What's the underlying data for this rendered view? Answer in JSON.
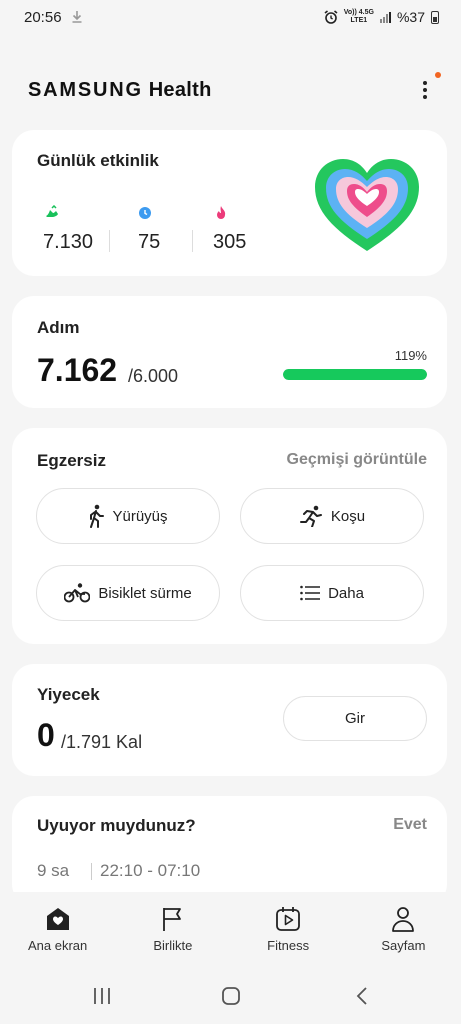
{
  "status": {
    "time": "20:56",
    "net_top": "Vo)) 4.5G",
    "net_bottom": "LTE1",
    "battery": "%37"
  },
  "app": {
    "brand": "SAMSUNG",
    "product": "Health"
  },
  "daily": {
    "title": "Günlük etkinlik",
    "stats": [
      {
        "icon": "shoe-icon",
        "value": "7.130",
        "color": "#19c15b"
      },
      {
        "icon": "clock-icon",
        "value": "75",
        "color": "#3d9bf0"
      },
      {
        "icon": "flame-icon",
        "value": "305",
        "color": "#ec3b7a"
      }
    ]
  },
  "steps": {
    "title": "Adım",
    "value": "7.162",
    "goal": "/6.000",
    "percent_label": "119%",
    "progress": 1.0
  },
  "exercise": {
    "title": "Egzersiz",
    "history": "Geçmişi görüntüle",
    "buttons": [
      {
        "label": "Yürüyüş",
        "icon": "walking-icon"
      },
      {
        "label": "Koşu",
        "icon": "running-icon"
      },
      {
        "label": "Bisiklet sürme",
        "icon": "cycling-icon"
      },
      {
        "label": "Daha",
        "icon": "list-icon"
      }
    ]
  },
  "food": {
    "title": "Yiyecek",
    "value": "0",
    "goal": "/1.791 Kal",
    "button": "Gir"
  },
  "sleep": {
    "title": "Uyuyor muydunuz?",
    "action": "Evet",
    "duration": "9 sa",
    "range": "22:10 - 07:10"
  },
  "nav": [
    {
      "label": "Ana ekran",
      "icon": "home-heart-icon"
    },
    {
      "label": "Birlikte",
      "icon": "flag-icon"
    },
    {
      "label": "Fitness",
      "icon": "play-calendar-icon"
    },
    {
      "label": "Sayfam",
      "icon": "person-icon"
    }
  ],
  "colors": {
    "accent_green": "#16c95c",
    "notification": "#f26522"
  }
}
